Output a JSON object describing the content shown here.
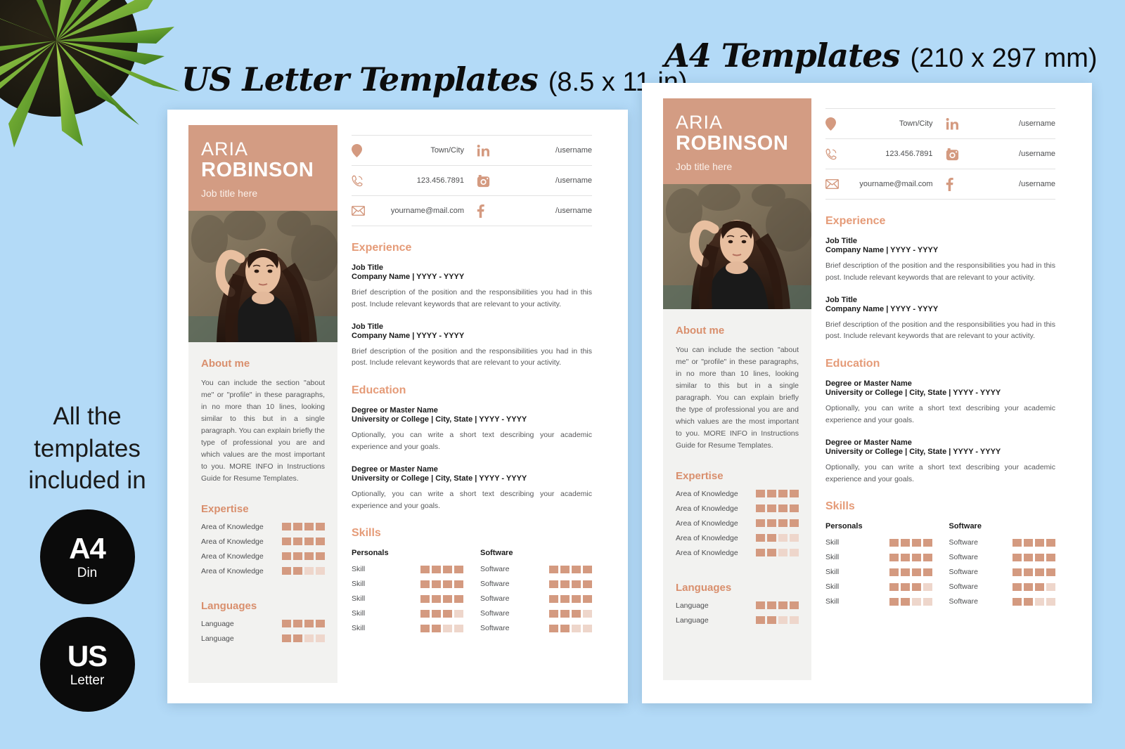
{
  "accent": "#d39c83",
  "accent_heading": "#e59b78",
  "background": "#b3daf7",
  "headings": {
    "us_script": "US Letter Templates",
    "us_dims": "(8.5 x 11 in)",
    "a4_script": "A4 Templates",
    "a4_dims": "(210 x 297 mm)"
  },
  "promo": {
    "line1": "All the",
    "line2": "templates",
    "line3": "included in",
    "badges": [
      {
        "top": "A4",
        "bottom": "Din"
      },
      {
        "top": "US",
        "bottom": "Letter"
      }
    ]
  },
  "resume": {
    "first_name": "ARIA",
    "last_name": "ROBINSON",
    "job_title": "Job title here",
    "contacts": [
      {
        "icon": "location-pin-icon",
        "value": "Town/City",
        "social_icon": "linkedin-icon",
        "social_value": "/username"
      },
      {
        "icon": "phone-icon",
        "value": "123.456.7891",
        "social_icon": "instagram-icon",
        "social_value": "/username"
      },
      {
        "icon": "envelope-icon",
        "value": "yourname@mail.com",
        "social_icon": "facebook-icon",
        "social_value": "/username"
      }
    ],
    "about": {
      "heading": "About me",
      "body": "You can include the section \"about me\" or \"profile\" in these paragraphs, in no more than 10 lines, looking similar to this but in a single paragraph. You can explain briefly the type of professional you are and which values are the most important to you. MORE INFO in Instructions Guide for Resume Templates."
    },
    "experience": {
      "heading": "Experience",
      "items": [
        {
          "title": "Job Title",
          "subtitle": "Company Name | YYYY - YYYY",
          "body": "Brief description of the position and the responsibilities you had in this post. Include relevant keywords that are relevant to your activity."
        },
        {
          "title": "Job Title",
          "subtitle": "Company Name | YYYY - YYYY",
          "body": "Brief description of the position and the responsibilities you had in this post. Include relevant keywords that are relevant to your activity."
        }
      ]
    },
    "education": {
      "heading": "Education",
      "items": [
        {
          "title": "Degree or Master Name",
          "subtitle": "University or College | City, State | YYYY - YYYY",
          "body": "Optionally, you can write a short text describing your academic experience and your goals."
        },
        {
          "title": "Degree or Master Name",
          "subtitle": "University or College | City, State | YYYY - YYYY",
          "body": "Optionally, you can write a short text describing your academic experience and your goals."
        }
      ]
    },
    "expertise": {
      "heading": "Expertise",
      "us_rows": [
        {
          "label": "Area of Knowledge",
          "filled": 4,
          "total": 4
        },
        {
          "label": "Area of Knowledge",
          "filled": 4,
          "total": 4
        },
        {
          "label": "Area of Knowledge",
          "filled": 4,
          "total": 4
        },
        {
          "label": "Area of Knowledge",
          "filled": 2,
          "total": 4
        }
      ],
      "a4_rows": [
        {
          "label": "Area of Knowledge",
          "filled": 4,
          "total": 4
        },
        {
          "label": "Area of Knowledge",
          "filled": 4,
          "total": 4
        },
        {
          "label": "Area of Knowledge",
          "filled": 4,
          "total": 4
        },
        {
          "label": "Area of Knowledge",
          "filled": 2,
          "total": 4
        },
        {
          "label": "Area of Knowledge",
          "filled": 2,
          "total": 4
        }
      ]
    },
    "languages": {
      "heading": "Languages",
      "rows": [
        {
          "label": "Language",
          "filled": 4,
          "total": 4
        },
        {
          "label": "Language",
          "filled": 2,
          "total": 4
        }
      ]
    },
    "skills": {
      "heading": "Skills",
      "col1_header": "Personals",
      "col2_header": "Software",
      "personals": [
        {
          "label": "Skill",
          "filled": 4,
          "total": 4
        },
        {
          "label": "Skill",
          "filled": 4,
          "total": 4
        },
        {
          "label": "Skill",
          "filled": 4,
          "total": 4
        },
        {
          "label": "Skill",
          "filled": 3,
          "total": 4
        },
        {
          "label": "Skill",
          "filled": 2,
          "total": 4
        }
      ],
      "software": [
        {
          "label": "Software",
          "filled": 4,
          "total": 4
        },
        {
          "label": "Software",
          "filled": 4,
          "total": 4
        },
        {
          "label": "Software",
          "filled": 4,
          "total": 4
        },
        {
          "label": "Software",
          "filled": 3,
          "total": 4
        },
        {
          "label": "Software",
          "filled": 2,
          "total": 4
        }
      ]
    }
  }
}
